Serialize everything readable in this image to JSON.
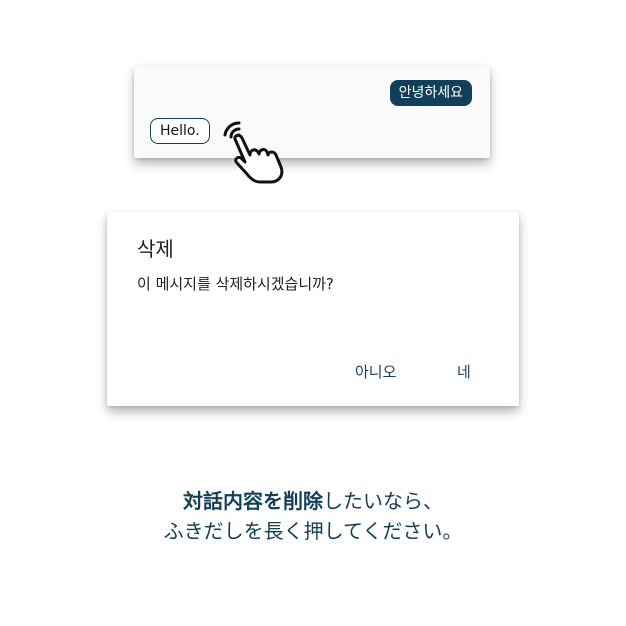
{
  "chat": {
    "received_message": "안녕하세요",
    "sent_message": "Hello.",
    "gesture_icon": "hand-long-press-icon"
  },
  "dialog": {
    "title": "삭제",
    "message": "이 메시지를 삭제하시겠습니까?",
    "cancel_label": "아니오",
    "confirm_label": "네"
  },
  "caption": {
    "line1_bold": "対話内容を削除",
    "line1_rest": "したいなら、",
    "line2": "ふきだしを長く押してください。"
  },
  "colors": {
    "accent": "#123f5a",
    "background": "#ffffff",
    "card": "#fafafa"
  }
}
